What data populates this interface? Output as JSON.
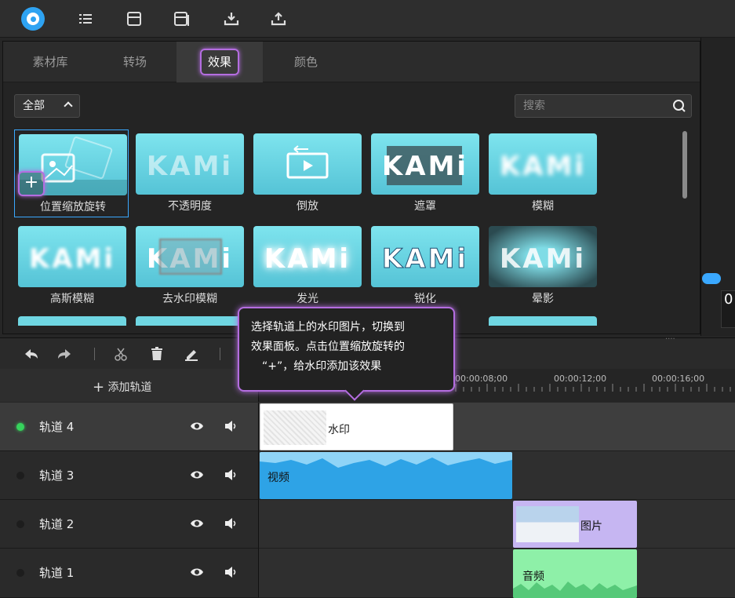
{
  "app": {
    "topbar": {
      "icons": [
        "app-logo",
        "menu-icon",
        "save-icon",
        "save-as-icon",
        "import-icon",
        "export-icon"
      ]
    },
    "tabs": [
      {
        "label": "素材库"
      },
      {
        "label": "转场"
      },
      {
        "label": "效果",
        "active": true
      },
      {
        "label": "颜色"
      }
    ],
    "filter": {
      "label": "全部"
    },
    "search": {
      "placeholder": "搜索"
    },
    "effects": [
      {
        "label": "位置缩放旋转",
        "thumb": "picture-zoom"
      },
      {
        "label": "不透明度",
        "thumb": "kami-faded"
      },
      {
        "label": "倒放",
        "thumb": "reverse-play"
      },
      {
        "label": "遮罩",
        "thumb": "kami-mask"
      },
      {
        "label": "模糊",
        "thumb": "kami-blur"
      },
      {
        "label": "高斯模糊",
        "thumb": "kami-gauss"
      },
      {
        "label": "去水印模糊",
        "thumb": "kami-watermark"
      },
      {
        "label": "发光",
        "thumb": "kami-glow"
      },
      {
        "label": "锐化",
        "thumb": "kami-sharpen"
      },
      {
        "label": "晕影",
        "thumb": "kami-vignette"
      }
    ],
    "kami_text": "KAMi",
    "plus_label": "+",
    "preview": {
      "time_digit": "0"
    },
    "tooltip": {
      "line1": "选择轨道上的水印图片，切换到",
      "line2": "效果面板。点击位置缩放旋转的",
      "line3": "“+”，给水印添加该效果"
    },
    "timeline": {
      "add_track_label": "添加轨道",
      "ruler": [
        "00:00:08;00",
        "00:00:12;00",
        "00:00:16;00"
      ],
      "tracks": [
        {
          "name": "轨道 4",
          "active": true
        },
        {
          "name": "轨道 3",
          "active": false
        },
        {
          "name": "轨道 2",
          "active": false
        },
        {
          "name": "轨道 1",
          "active": false
        }
      ],
      "clips": {
        "watermark": "水印",
        "video": "视频",
        "image": "图片",
        "audio": "音频"
      }
    },
    "colors": {
      "accent": "#b46de0",
      "selection": "#3aa8ff",
      "video_clip": "#2ea3e6",
      "image_clip": "#c6b6f2",
      "audio_clip": "#8ef0a8",
      "active_dot": "#36d35c"
    }
  }
}
